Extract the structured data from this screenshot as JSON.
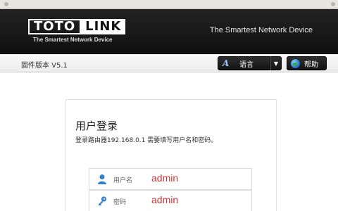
{
  "header": {
    "logo_left": "TOTO",
    "logo_right": "LINK",
    "logo_tagline": "The Smartest Network Device",
    "tagline_right": "The Smartest Network Device"
  },
  "toolbar": {
    "firmware_label": "固件版本 V5.1",
    "language_label": "语言",
    "help_label": "帮助"
  },
  "login": {
    "title": "用户登录",
    "description": "登录路由器192.168.0.1 需要填写用户名和密码。",
    "username_label": "用户名",
    "username_value": "admin",
    "password_label": "密码",
    "password_value": "admin"
  },
  "colors": {
    "header_bg": "#141414",
    "input_text": "#cc3333",
    "icon_blue": "#2f7fd1"
  }
}
